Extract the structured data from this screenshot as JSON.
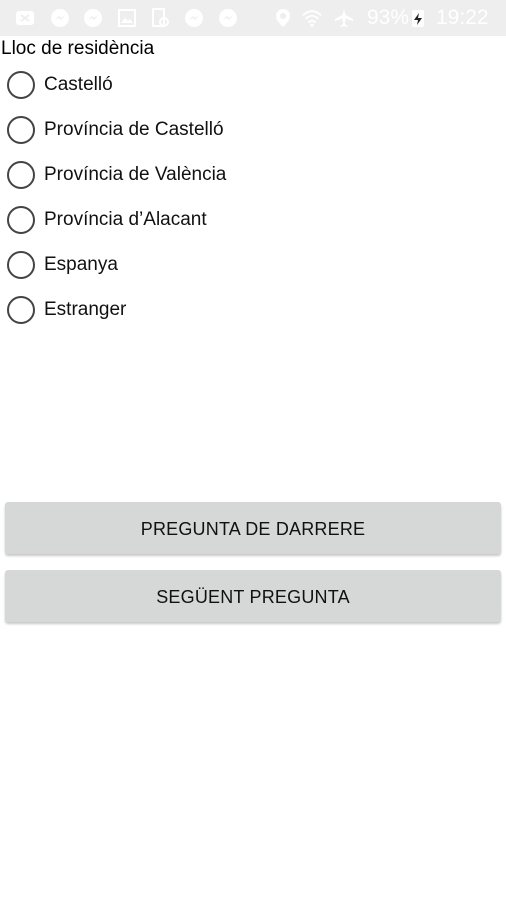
{
  "status_bar": {
    "battery_text": "93%",
    "time": "19:22",
    "background_color": "#eeeeee",
    "icons": [
      "notification-icon",
      "messenger-icon",
      "messenger-icon",
      "gallery-icon",
      "data-saver-icon",
      "messenger-icon",
      "messenger-icon",
      "location-icon",
      "wifi-icon",
      "airplane-mode-icon",
      "charging-icon"
    ]
  },
  "question": {
    "title": "Lloc de residència",
    "options": [
      {
        "label": "Castelló",
        "selected": false
      },
      {
        "label": "Província de Castelló",
        "selected": false
      },
      {
        "label": "Província de València",
        "selected": false
      },
      {
        "label": "Província d’Alacant",
        "selected": false
      },
      {
        "label": "Espanya",
        "selected": false
      },
      {
        "label": "Estranger",
        "selected": false
      }
    ]
  },
  "buttons": {
    "previous_label": "PREGUNTA DE DARRERE",
    "next_label": "SEGÜENT PREGUNTA",
    "button_color": "#d6d7d7"
  }
}
